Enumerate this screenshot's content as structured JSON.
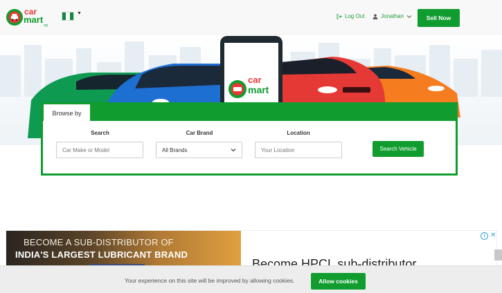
{
  "header": {
    "logo_text_top": "car",
    "logo_text_bottom": "mart",
    "logo_suffix": ".ng",
    "flag_colors": [
      "#118a3e",
      "#ffffff",
      "#118a3e"
    ],
    "logout_label": "Log Out",
    "user_name": "Jonathan",
    "sell_label": "Sell Now"
  },
  "hero": {
    "phone_logo_top": "car",
    "phone_logo_bottom": "mart"
  },
  "search": {
    "tab_label": "Browse by",
    "search_label": "Search",
    "search_placeholder": "Car Make or Model",
    "brand_label": "Car Brand",
    "brand_selected": "All Brands",
    "location_label": "Location",
    "location_placeholder": "Your Location",
    "button_label": "Search Vehicle"
  },
  "ad": {
    "line1": "BECOME A SUB-DISTRIBUTOR OF",
    "line2": "INDIA'S LARGEST LUBRICANT BRAND",
    "headline": "Become HPCL sub-distributor",
    "info_icon": "i",
    "close_icon": "✕"
  },
  "cookie": {
    "message": "Your experience on this site will be improved by allowing cookies.",
    "button_label": "Allow cookies"
  },
  "colors": {
    "brand_green": "#109c2e",
    "logo_red": "#e53935"
  }
}
